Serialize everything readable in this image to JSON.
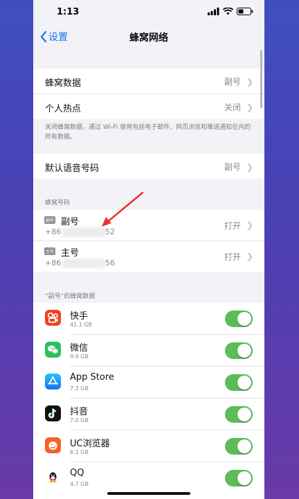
{
  "status": {
    "time": "1:13"
  },
  "nav": {
    "back": "设置",
    "title": "蜂窝网络"
  },
  "group1": [
    {
      "label": "蜂窝数据",
      "value": "副号"
    },
    {
      "label": "个人热点",
      "value": "关闭"
    }
  ],
  "footnote": "关闭蜂窝数据，通过 Wi-Fi 使用包括电子邮件、网页浏览和推送通知在内的所有数据。",
  "voice": {
    "label": "默认语音号码",
    "value": "副号"
  },
  "sim_section": "蜂窝号码",
  "sims": [
    {
      "tag": "副号",
      "name": "副号",
      "num_prefix": "+86",
      "num_suffix": "52",
      "state": "打开"
    },
    {
      "tag": "主号",
      "name": "主号",
      "num_prefix": "+86",
      "num_suffix": "56",
      "state": "打开"
    }
  ],
  "apps_section": "“副号”的蜂窝数据",
  "apps": [
    {
      "name": "快手",
      "size": "41.1 GB",
      "enabled": true
    },
    {
      "name": "微信",
      "size": "9.9 GB",
      "enabled": true
    },
    {
      "name": "App Store",
      "size": "7.3 GB",
      "enabled": true
    },
    {
      "name": "抖音",
      "size": "7.0 GB",
      "enabled": true
    },
    {
      "name": "UC浏览器",
      "size": "6.1 GB",
      "enabled": true
    },
    {
      "name": "QQ",
      "size": "4.7 GB",
      "enabled": true
    }
  ],
  "colors": {
    "accent": "#1a73e8",
    "toggle_on": "#5dbb58",
    "annotation_arrow": "#e8322c"
  }
}
